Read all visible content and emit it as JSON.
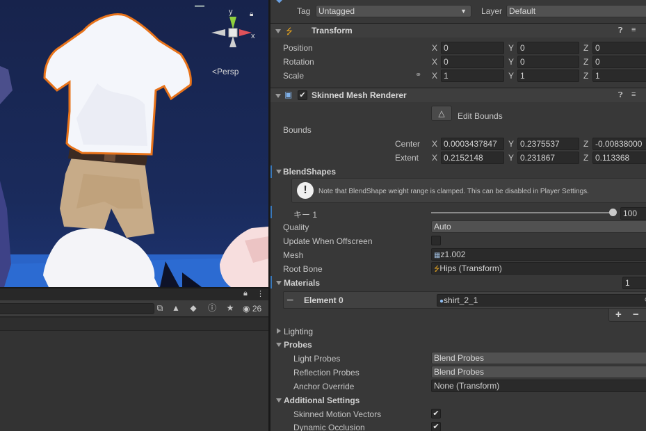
{
  "scene": {
    "gizmo_y": "y",
    "gizmo_x": "x",
    "persp_label": "Persp"
  },
  "project": {
    "hidden_count": "26"
  },
  "inspector": {
    "tag_label": "Tag",
    "tag_value": "Untagged",
    "layer_label": "Layer",
    "layer_value": "Default",
    "transform": {
      "title": "Transform",
      "position_label": "Position",
      "rotation_label": "Rotation",
      "scale_label": "Scale",
      "position": {
        "x": "0",
        "y": "0",
        "z": "0"
      },
      "rotation": {
        "x": "0",
        "y": "0",
        "z": "0"
      },
      "scale": {
        "x": "1",
        "y": "1",
        "z": "1"
      }
    },
    "axes": {
      "x": "X",
      "y": "Y",
      "z": "Z"
    },
    "smr": {
      "title": "Skinned Mesh Renderer",
      "edit_bounds": "Edit Bounds",
      "bounds_label": "Bounds",
      "center_label": "Center",
      "extent_label": "Extent",
      "center": {
        "x": "0.0003437847",
        "y": "0.2375537",
        "z": "-0.00838000"
      },
      "extent": {
        "x": "0.2152148",
        "y": "0.231867",
        "z": "0.113368"
      },
      "blendshapes_label": "BlendShapes",
      "blendshape_note": "Note that BlendShape weight range is clamped. This can be disabled in Player Settings.",
      "key_label": "キー 1",
      "key_value": "100",
      "key_fraction": 1.0,
      "quality_label": "Quality",
      "quality_value": "Auto",
      "update_offscreen_label": "Update When Offscreen",
      "mesh_label": "Mesh",
      "mesh_value": "z1.002",
      "root_bone_label": "Root Bone",
      "root_bone_value": "Hips (Transform)",
      "materials_label": "Materials",
      "materials_count": "1",
      "element0_label": "Element 0",
      "element0_value": "shirt_2_1",
      "add_label": "+",
      "remove_label": "−",
      "lighting_label": "Lighting",
      "probes_label": "Probes",
      "light_probes_label": "Light Probes",
      "light_probes_value": "Blend Probes",
      "reflection_probes_label": "Reflection Probes",
      "reflection_probes_value": "Blend Probes",
      "anchor_override_label": "Anchor Override",
      "anchor_override_value": "None (Transform)",
      "additional_label": "Additional Settings",
      "skinned_motion_label": "Skinned Motion Vectors",
      "dynamic_occlusion_label": "Dynamic Occlusion"
    }
  },
  "colors": {
    "selection_outline": "#e8731a",
    "inspector_bg": "#383838",
    "field_bg": "#2a2a2a",
    "accent_blue": "#3a79bb"
  }
}
